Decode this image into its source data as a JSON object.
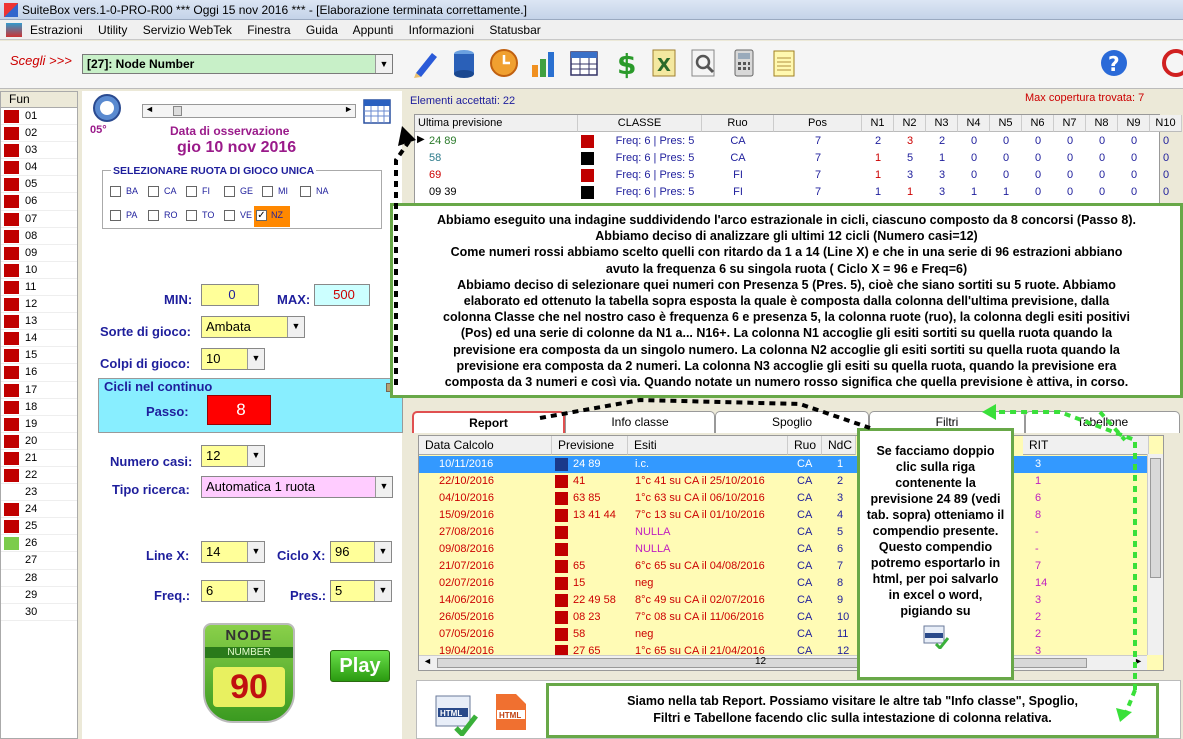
{
  "window": {
    "title": "SuiteBox vers.1-0-PRO-R00  ***  Oggi 15 nov 2016  ***  - [Elaborazione terminata correttamente.]"
  },
  "menu": [
    "Estrazioni",
    "Utility",
    "Servizio WebTek",
    "Finestra",
    "Guida",
    "Appunti",
    "Informazioni",
    "Statusbar"
  ],
  "toolbar": {
    "scegli_label": "Scegli >>>",
    "combo_value": "[27]: Node Number"
  },
  "fun": {
    "header": "Fun",
    "rows": [
      {
        "n": "01",
        "c": "r"
      },
      {
        "n": "02",
        "c": "r"
      },
      {
        "n": "03",
        "c": "r"
      },
      {
        "n": "04",
        "c": "r"
      },
      {
        "n": "05",
        "c": "r"
      },
      {
        "n": "06",
        "c": "r"
      },
      {
        "n": "07",
        "c": "r"
      },
      {
        "n": "08",
        "c": "r"
      },
      {
        "n": "09",
        "c": "r"
      },
      {
        "n": "10",
        "c": "r"
      },
      {
        "n": "11",
        "c": "r"
      },
      {
        "n": "12",
        "c": "r"
      },
      {
        "n": "13",
        "c": "r"
      },
      {
        "n": "14",
        "c": "r"
      },
      {
        "n": "15",
        "c": "r"
      },
      {
        "n": "16",
        "c": "r"
      },
      {
        "n": "17",
        "c": "r"
      },
      {
        "n": "18",
        "c": "r"
      },
      {
        "n": "19",
        "c": "r"
      },
      {
        "n": "20",
        "c": "r"
      },
      {
        "n": "21",
        "c": "r"
      },
      {
        "n": "22",
        "c": "r"
      },
      {
        "n": "23",
        "c": ""
      },
      {
        "n": "24",
        "c": "r"
      },
      {
        "n": "25",
        "c": "r"
      },
      {
        "n": "26",
        "c": "g"
      },
      {
        "n": "27",
        "c": ""
      },
      {
        "n": "28",
        "c": ""
      },
      {
        "n": "29",
        "c": ""
      },
      {
        "n": "30",
        "c": ""
      }
    ]
  },
  "left": {
    "angle": "05°",
    "obs_label": "Data di osservazione",
    "obs_date": "gio 10 nov 2016",
    "ruota_title": "SELEZIONARE RUOTA DI GIOCO UNICA",
    "ruote": [
      "BA",
      "CA",
      "FI",
      "GE",
      "MI",
      "NA",
      "PA",
      "RO",
      "TO",
      "VE",
      "NZ"
    ],
    "min_label": "MIN:",
    "min_value": "0",
    "max_label": "MAX:",
    "max_value": "500",
    "sorte_label": "Sorte di gioco:",
    "sorte_value": "Ambata",
    "colpi_label": "Colpi di gioco:",
    "colpi_value": "10",
    "cicli_title": "Cicli nel continuo",
    "passo_label": "Passo:",
    "passo_value": "8",
    "casi_label": "Numero casi:",
    "casi_value": "12",
    "tipo_label": "Tipo ricerca:",
    "tipo_value": "Automatica 1 ruota",
    "linex_label": "Line X:",
    "linex_value": "14",
    "ciclox_label": "Ciclo X:",
    "ciclox_value": "96",
    "freq_label": "Freq.:",
    "freq_value": "6",
    "pres_label": "Pres.:",
    "pres_value": "5",
    "logo_top": "NODE",
    "logo_mid": "NUMBER",
    "logo_num": "90",
    "play_label": "Play"
  },
  "top": {
    "accepted": "Elementi accettati: 22",
    "max_cov": "Max copertura trovata:   7",
    "headers": [
      "Ultima previsione",
      "CLASSE",
      "Ruo",
      "Pos",
      "N1",
      "N2",
      "N3",
      "N4",
      "N5",
      "N6",
      "N7",
      "N8",
      "N9",
      "N10"
    ],
    "rows": [
      {
        "prev": "24 89",
        "col": "#2a7a2a",
        "sq": "#c00000",
        "classe": "Freq: 6 | Pres: 5",
        "ruo": "CA",
        "pos": "7",
        "n": [
          "2",
          "3",
          "2",
          "0",
          "0",
          "0",
          "0",
          "0",
          "0",
          "0"
        ]
      },
      {
        "prev": "58",
        "col": "#2a7a8a",
        "sq": "#000",
        "classe": "Freq: 6 | Pres: 5",
        "ruo": "CA",
        "pos": "7",
        "n": [
          "1",
          "5",
          "1",
          "0",
          "0",
          "0",
          "0",
          "0",
          "0",
          "0"
        ]
      },
      {
        "prev": "69",
        "col": "#c00",
        "sq": "#c00000",
        "classe": "Freq: 6 | Pres: 5",
        "ruo": "FI",
        "pos": "7",
        "n": [
          "1",
          "3",
          "3",
          "0",
          "0",
          "0",
          "0",
          "0",
          "0",
          "0"
        ]
      },
      {
        "prev": "09 39",
        "col": "#000",
        "sq": "#000",
        "classe": "Freq: 6 | Pres: 5",
        "ruo": "FI",
        "pos": "7",
        "n": [
          "1",
          "1",
          "3",
          "1",
          "1",
          "0",
          "0",
          "0",
          "0",
          "0"
        ]
      }
    ]
  },
  "callout1": [
    "Abbiamo eseguito una indagine suddividendo l'arco estrazionale in cicli, ciascuno composto da 8 concorsi (Passo 8).",
    "Abbiamo deciso di analizzare gli ultimi 12 cicli (Numero casi=12)",
    "Come numeri rossi abbiamo scelto quelli con ritardo da 1 a 14 (Line X) e che in una serie di 96 estrazioni abbiano",
    "avuto la frequenza 6 su singola ruota ( Ciclo X = 96 e Freq=6)",
    "Abbiamo deciso di selezionare quei numeri con Presenza 5 (Pres. 5), cioè che siano sortiti su 5 ruote. Abbiamo",
    "elaborato ed ottenuto la tabella sopra esposta la quale è composta dalla colonna dell'ultima previsione, dalla",
    "colonna Classe che nel nostro caso è frequenza 6 e presenza 5, la colonna ruote (ruo), la colonna degli esiti positivi",
    "(Pos) ed una serie di colonne da N1 a... N16+. La colonna N1 accoglie gli esiti sortiti su quella ruota quando la",
    "previsione era composta da un singolo numero. La colonna N2 accoglie gli esiti sortiti su quella ruota quando la",
    "previsione era composta da 2 numeri. La colonna N3 accoglie gli esiti su quella ruota, quando la previsione era",
    "composta da 3 numeri e così via. Quando notate un numero rosso significa che quella previsione è attiva, in corso."
  ],
  "tabs": [
    "Report",
    "Info classe",
    "Spoglio",
    "Filtri",
    "Tabellone"
  ],
  "bottom": {
    "headers": [
      "Data Calcolo",
      "Previsione",
      "Esiti",
      "Ruo",
      "NdC",
      "RIT"
    ],
    "rows": [
      {
        "date": "10/11/2016",
        "prev": "24 89",
        "esiti": "i.c.",
        "ruo": "CA",
        "ndc": "1",
        "rit": "3",
        "sel": true
      },
      {
        "date": "22/10/2016",
        "prev": "41",
        "esiti": "1°c 41 su CA il 25/10/2016",
        "ruo": "CA",
        "ndc": "2",
        "rit": "1"
      },
      {
        "date": "04/10/2016",
        "prev": "63 85",
        "esiti": "1°c 63 su CA il 06/10/2016",
        "ruo": "CA",
        "ndc": "3",
        "rit": "6"
      },
      {
        "date": "15/09/2016",
        "prev": "13 41 44",
        "esiti": "7°c 13 su CA il 01/10/2016",
        "ruo": "CA",
        "ndc": "4",
        "rit": "8"
      },
      {
        "date": "27/08/2016",
        "prev": "",
        "esiti": "NULLA",
        "ruo": "CA",
        "ndc": "5",
        "rit": "-",
        "nulla": true
      },
      {
        "date": "09/08/2016",
        "prev": "",
        "esiti": "NULLA",
        "ruo": "CA",
        "ndc": "6",
        "rit": "-",
        "nulla": true
      },
      {
        "date": "21/07/2016",
        "prev": "65",
        "esiti": "6°c 65 su CA il 04/08/2016",
        "ruo": "CA",
        "ndc": "7",
        "rit": "7"
      },
      {
        "date": "02/07/2016",
        "prev": "15",
        "esiti": "neg",
        "ruo": "CA",
        "ndc": "8",
        "rit": "14"
      },
      {
        "date": "14/06/2016",
        "prev": "22 49 58",
        "esiti": "8°c 49 su CA il 02/07/2016",
        "ruo": "CA",
        "ndc": "9",
        "rit": "3"
      },
      {
        "date": "26/05/2016",
        "prev": "08 23",
        "esiti": "7°c 08 su CA il 11/06/2016",
        "ruo": "CA",
        "ndc": "10",
        "rit": "2"
      },
      {
        "date": "07/05/2016",
        "prev": "58",
        "esiti": "neg",
        "ruo": "CA",
        "ndc": "11",
        "rit": "2"
      },
      {
        "date": "19/04/2016",
        "prev": "27 65",
        "esiti": "1°c 65 su CA il 21/04/2016",
        "ruo": "CA",
        "ndc": "12",
        "rit": "3"
      }
    ],
    "scroll_value": "12"
  },
  "callout2": "Se facciamo doppio clic sulla riga contenente la previsione 24 89 (vedi tab. sopra) otteniamo il compendio presente. Questo compendio potremo esportarlo in html, per poi salvarlo in excel o word, pigiando su",
  "callout3": [
    "Siamo nella tab Report. Possiamo visitare le altre tab \"Info classe\", Spoglio,",
    "Filtri e Tabellone facendo clic sulla intestazione di colonna relativa."
  ],
  "html_icon_label": "HTML"
}
